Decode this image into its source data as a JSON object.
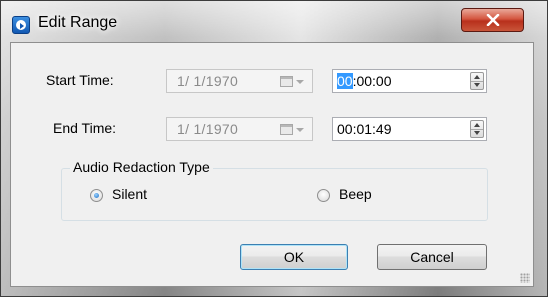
{
  "window": {
    "title": "Edit Range",
    "close_label": "X"
  },
  "start": {
    "label": "Start Time:",
    "date": "1/ 1/1970",
    "time_selected": "00",
    "time_rest": ":00:00"
  },
  "end": {
    "label": "End Time:",
    "date": "1/ 1/1970",
    "time": "00:01:49"
  },
  "redaction": {
    "legend": "Audio Redaction Type",
    "options": [
      {
        "label": "Silent",
        "checked": true
      },
      {
        "label": "Beep",
        "checked": false
      }
    ]
  },
  "buttons": {
    "ok": "OK",
    "cancel": "Cancel"
  },
  "colors": {
    "selection": "#3399ff",
    "default_button_border": "#3c7fb1"
  }
}
